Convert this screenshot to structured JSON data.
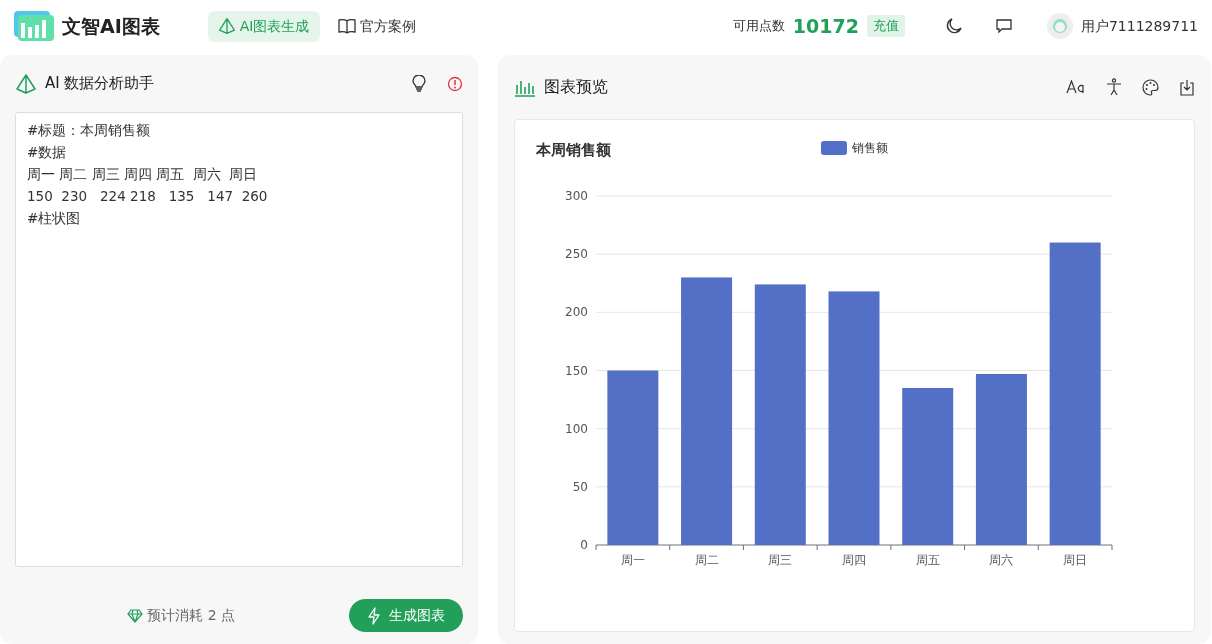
{
  "brand": {
    "name": "文智AI图表"
  },
  "nav": [
    {
      "label": "AI图表生成",
      "selected": true
    },
    {
      "label": "官方案例",
      "selected": false
    }
  ],
  "points": {
    "label": "可用点数",
    "value": "10172",
    "recharge": "充值"
  },
  "user": {
    "name": "用户7111289711"
  },
  "assistant": {
    "title": "AI 数据分析助手",
    "input_lines": [
      "#标题：本周销售额",
      "#数据",
      "周一 周二 周三 周四 周五  周六  周日",
      "150  230   224 218   135   147  260",
      "#柱状图"
    ],
    "cost": "预计消耗 2 点",
    "generate": "生成图表"
  },
  "preview": {
    "title": "图表预览",
    "chart_data": {
      "type": "bar",
      "title": "本周销售额",
      "categories": [
        "周一",
        "周二",
        "周三",
        "周四",
        "周五",
        "周六",
        "周日"
      ],
      "series": [
        {
          "name": "销售额",
          "color": "#5470c6",
          "values": [
            150,
            230,
            224,
            218,
            135,
            147,
            260
          ]
        }
      ],
      "ylim": [
        0,
        300
      ],
      "grid": true,
      "yticks": [
        0,
        50,
        100,
        150,
        200,
        250,
        300
      ]
    }
  }
}
